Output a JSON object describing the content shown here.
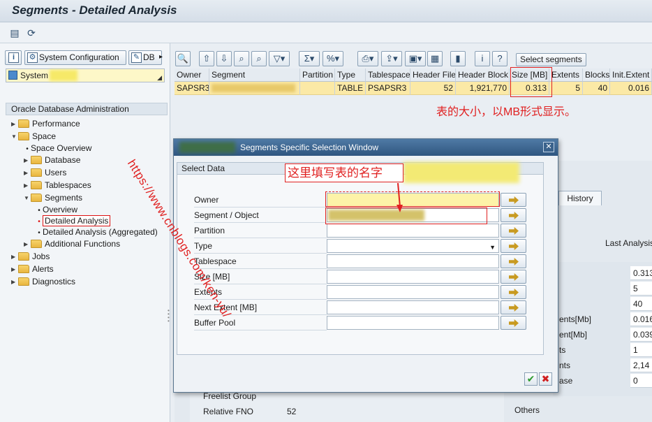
{
  "window": {
    "title": "Segments - Detailed Analysis"
  },
  "left": {
    "btn_sysconfig": "System Configuration",
    "btn_db": "DB",
    "system_label": "System",
    "tree_header": "Oracle Database Administration",
    "tree": {
      "performance": "Performance",
      "space": "Space",
      "space_overview": "Space Overview",
      "database": "Database",
      "users": "Users",
      "tablespaces": "Tablespaces",
      "segments": "Segments",
      "overview": "Overview",
      "detailed_analysis": "Detailed Analysis",
      "detailed_analysis_agg": "Detailed Analysis (Aggregated)",
      "additional_functions": "Additional Functions",
      "jobs": "Jobs",
      "alerts": "Alerts",
      "diagnostics": "Diagnostics"
    }
  },
  "results": {
    "select_segments": "Select segments",
    "columns": [
      "Owner",
      "Segment",
      "Partition",
      "Type",
      "Tablespace",
      "Header File",
      "Header Block",
      "Size [MB]",
      "Extents",
      "Blocks",
      "Init.Extent"
    ],
    "row": {
      "owner": "SAPSR3",
      "partition": "",
      "type": "TABLE",
      "tablespace": "PSAPSR3",
      "header_file": "52",
      "header_block": "1,921,770",
      "size_mb": "0.313",
      "extents": "5",
      "blocks": "40",
      "init_extent": "0.016"
    },
    "annotation": "表的大小，以MB形式显示。"
  },
  "background": {
    "history_tab": "History",
    "last_analysis": "Last Analysis",
    "values": [
      "0.313",
      "5",
      "40",
      "0.016",
      "0.039",
      "1",
      "2,14",
      "0"
    ],
    "labels": [
      "ents[Mb]",
      "ent[Mb]",
      "ts",
      "nts",
      "ase"
    ],
    "freelist_group": "Freelist Group",
    "relative_fno": "Relative FNO",
    "relative_fno_value": "52",
    "others": "Others"
  },
  "dialog": {
    "title": "Segments Specific Selection Window",
    "tab": "Select Data",
    "annotation": "这里填写表的名字",
    "fields": {
      "owner": "Owner",
      "segment": "Segment / Object",
      "partition": "Partition",
      "type": "Type",
      "tablespace": "Tablespace",
      "size": "Size [MB]",
      "extents": "Extents",
      "next_extent": "Next Extent [MB]",
      "buffer_pool": "Buffer Pool"
    }
  },
  "watermark": "https://www.cnblogs.com/ken-yu/",
  "colors": {
    "accent_red": "#e02020",
    "highlight_yellow": "#fbe9a6",
    "dialog_header": "#2f5680"
  }
}
